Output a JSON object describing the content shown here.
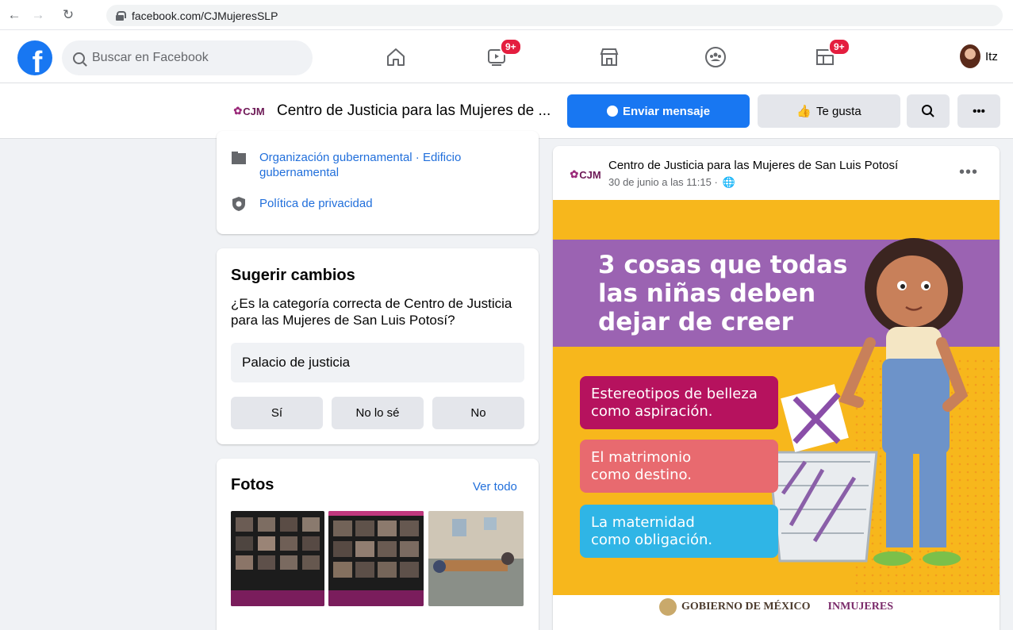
{
  "browser": {
    "url": "facebook.com/CJMujeresSLP"
  },
  "header": {
    "search_placeholder": "Buscar en Facebook",
    "watch_badge": "9+",
    "pages_badge": "9+",
    "profile_name": "Itz"
  },
  "page": {
    "logo_text": "CJM",
    "title": "Centro de Justicia para las Mujeres de ...",
    "message_button": "Enviar mensaje",
    "like_button": "Te gusta"
  },
  "about": {
    "category": "Organización gubernamental · Edificio gubernamental",
    "privacy": "Política de privacidad"
  },
  "suggest": {
    "title": "Sugerir cambios",
    "question": "¿Es la categoría correcta de Centro de Justicia para las Mujeres de San Luis Potosí?",
    "category_value": "Palacio de justicia",
    "options": [
      "Sí",
      "No lo sé",
      "No"
    ]
  },
  "photos": {
    "title": "Fotos",
    "see_all": "Ver todo"
  },
  "post": {
    "author": "Centro de Justicia para las Mujeres de San Luis Potosí",
    "date": "30 de junio a las 11:15 ·",
    "image": {
      "headline": [
        "3 cosas que todas",
        "las niñas deben",
        "dejar de creer"
      ],
      "items": [
        {
          "text": [
            "Estereotipos de belleza",
            "como aspiración."
          ],
          "color": "#b6125e"
        },
        {
          "text": [
            "El matrimonio",
            "como destino."
          ],
          "color": "#e86a6f"
        },
        {
          "text": [
            "La maternidad",
            "como obligación."
          ],
          "color": "#2fb5e6"
        }
      ],
      "footer_gov": "GOBIERNO DE MÉXICO",
      "footer_inm": "INMUJERES"
    }
  },
  "colors": {
    "fb_blue": "#1877f2",
    "badge_red": "#e41e3f",
    "link_blue": "#216fdb"
  }
}
